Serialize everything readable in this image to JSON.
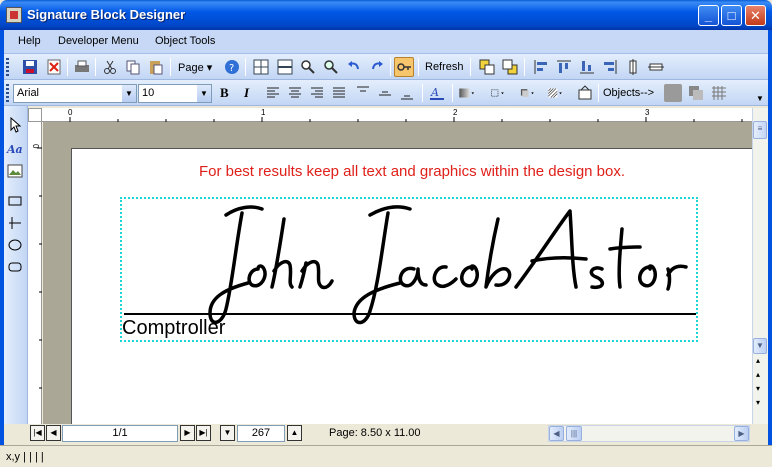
{
  "window": {
    "title": "Signature Block Designer",
    "minimize": "_",
    "maximize": "□",
    "close": "✕"
  },
  "menu": [
    "Help",
    "Developer Menu",
    "Object Tools"
  ],
  "toolbar1": {
    "page_label": "Page ▾",
    "refresh_label": "Refresh"
  },
  "toolbar2": {
    "font": "Arial",
    "size": "10",
    "bold": "B",
    "italic": "I",
    "objects_label": "Objects-->"
  },
  "ruler": {
    "h_labels": [
      "0",
      "1",
      "2",
      "3"
    ],
    "v_labels": [
      "0"
    ]
  },
  "canvas": {
    "hint": "For best results keep all text and graphics within the design box.",
    "signature": "John Jacob Astor",
    "caption": "Comptroller"
  },
  "nav": {
    "page": "1/1",
    "zoom": "267",
    "page_size": "Page: 8.50 x 11.00"
  },
  "status": {
    "text": "x,y  |  |  |  |"
  },
  "colors": {
    "accent": "#0058e6",
    "hint": "#e0201a",
    "design_box": "#1cd6d6"
  }
}
